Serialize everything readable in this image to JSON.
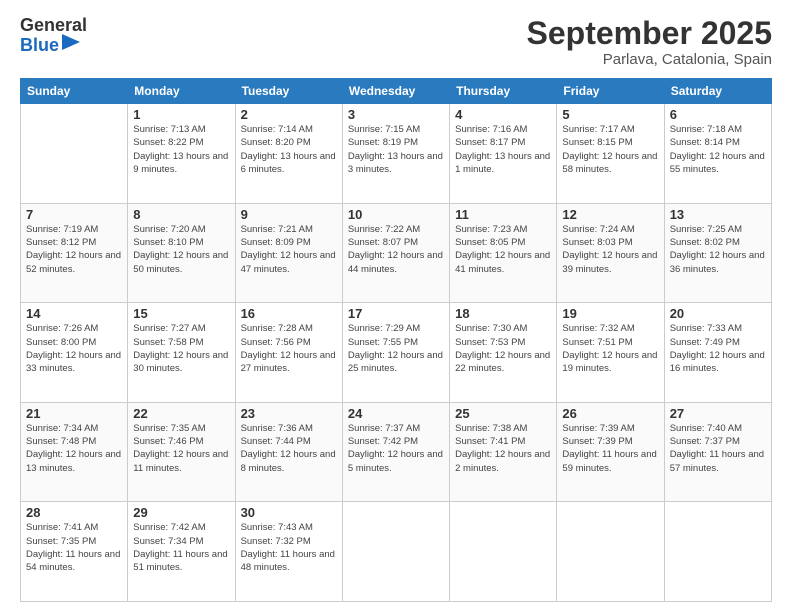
{
  "logo": {
    "general": "General",
    "blue": "Blue"
  },
  "header": {
    "month": "September 2025",
    "location": "Parlava, Catalonia, Spain"
  },
  "weekdays": [
    "Sunday",
    "Monday",
    "Tuesday",
    "Wednesday",
    "Thursday",
    "Friday",
    "Saturday"
  ],
  "weeks": [
    [
      {
        "day": "",
        "sunrise": "",
        "sunset": "",
        "daylight": ""
      },
      {
        "day": "1",
        "sunrise": "Sunrise: 7:13 AM",
        "sunset": "Sunset: 8:22 PM",
        "daylight": "Daylight: 13 hours and 9 minutes."
      },
      {
        "day": "2",
        "sunrise": "Sunrise: 7:14 AM",
        "sunset": "Sunset: 8:20 PM",
        "daylight": "Daylight: 13 hours and 6 minutes."
      },
      {
        "day": "3",
        "sunrise": "Sunrise: 7:15 AM",
        "sunset": "Sunset: 8:19 PM",
        "daylight": "Daylight: 13 hours and 3 minutes."
      },
      {
        "day": "4",
        "sunrise": "Sunrise: 7:16 AM",
        "sunset": "Sunset: 8:17 PM",
        "daylight": "Daylight: 13 hours and 1 minute."
      },
      {
        "day": "5",
        "sunrise": "Sunrise: 7:17 AM",
        "sunset": "Sunset: 8:15 PM",
        "daylight": "Daylight: 12 hours and 58 minutes."
      },
      {
        "day": "6",
        "sunrise": "Sunrise: 7:18 AM",
        "sunset": "Sunset: 8:14 PM",
        "daylight": "Daylight: 12 hours and 55 minutes."
      }
    ],
    [
      {
        "day": "7",
        "sunrise": "Sunrise: 7:19 AM",
        "sunset": "Sunset: 8:12 PM",
        "daylight": "Daylight: 12 hours and 52 minutes."
      },
      {
        "day": "8",
        "sunrise": "Sunrise: 7:20 AM",
        "sunset": "Sunset: 8:10 PM",
        "daylight": "Daylight: 12 hours and 50 minutes."
      },
      {
        "day": "9",
        "sunrise": "Sunrise: 7:21 AM",
        "sunset": "Sunset: 8:09 PM",
        "daylight": "Daylight: 12 hours and 47 minutes."
      },
      {
        "day": "10",
        "sunrise": "Sunrise: 7:22 AM",
        "sunset": "Sunset: 8:07 PM",
        "daylight": "Daylight: 12 hours and 44 minutes."
      },
      {
        "day": "11",
        "sunrise": "Sunrise: 7:23 AM",
        "sunset": "Sunset: 8:05 PM",
        "daylight": "Daylight: 12 hours and 41 minutes."
      },
      {
        "day": "12",
        "sunrise": "Sunrise: 7:24 AM",
        "sunset": "Sunset: 8:03 PM",
        "daylight": "Daylight: 12 hours and 39 minutes."
      },
      {
        "day": "13",
        "sunrise": "Sunrise: 7:25 AM",
        "sunset": "Sunset: 8:02 PM",
        "daylight": "Daylight: 12 hours and 36 minutes."
      }
    ],
    [
      {
        "day": "14",
        "sunrise": "Sunrise: 7:26 AM",
        "sunset": "Sunset: 8:00 PM",
        "daylight": "Daylight: 12 hours and 33 minutes."
      },
      {
        "day": "15",
        "sunrise": "Sunrise: 7:27 AM",
        "sunset": "Sunset: 7:58 PM",
        "daylight": "Daylight: 12 hours and 30 minutes."
      },
      {
        "day": "16",
        "sunrise": "Sunrise: 7:28 AM",
        "sunset": "Sunset: 7:56 PM",
        "daylight": "Daylight: 12 hours and 27 minutes."
      },
      {
        "day": "17",
        "sunrise": "Sunrise: 7:29 AM",
        "sunset": "Sunset: 7:55 PM",
        "daylight": "Daylight: 12 hours and 25 minutes."
      },
      {
        "day": "18",
        "sunrise": "Sunrise: 7:30 AM",
        "sunset": "Sunset: 7:53 PM",
        "daylight": "Daylight: 12 hours and 22 minutes."
      },
      {
        "day": "19",
        "sunrise": "Sunrise: 7:32 AM",
        "sunset": "Sunset: 7:51 PM",
        "daylight": "Daylight: 12 hours and 19 minutes."
      },
      {
        "day": "20",
        "sunrise": "Sunrise: 7:33 AM",
        "sunset": "Sunset: 7:49 PM",
        "daylight": "Daylight: 12 hours and 16 minutes."
      }
    ],
    [
      {
        "day": "21",
        "sunrise": "Sunrise: 7:34 AM",
        "sunset": "Sunset: 7:48 PM",
        "daylight": "Daylight: 12 hours and 13 minutes."
      },
      {
        "day": "22",
        "sunrise": "Sunrise: 7:35 AM",
        "sunset": "Sunset: 7:46 PM",
        "daylight": "Daylight: 12 hours and 11 minutes."
      },
      {
        "day": "23",
        "sunrise": "Sunrise: 7:36 AM",
        "sunset": "Sunset: 7:44 PM",
        "daylight": "Daylight: 12 hours and 8 minutes."
      },
      {
        "day": "24",
        "sunrise": "Sunrise: 7:37 AM",
        "sunset": "Sunset: 7:42 PM",
        "daylight": "Daylight: 12 hours and 5 minutes."
      },
      {
        "day": "25",
        "sunrise": "Sunrise: 7:38 AM",
        "sunset": "Sunset: 7:41 PM",
        "daylight": "Daylight: 12 hours and 2 minutes."
      },
      {
        "day": "26",
        "sunrise": "Sunrise: 7:39 AM",
        "sunset": "Sunset: 7:39 PM",
        "daylight": "Daylight: 11 hours and 59 minutes."
      },
      {
        "day": "27",
        "sunrise": "Sunrise: 7:40 AM",
        "sunset": "Sunset: 7:37 PM",
        "daylight": "Daylight: 11 hours and 57 minutes."
      }
    ],
    [
      {
        "day": "28",
        "sunrise": "Sunrise: 7:41 AM",
        "sunset": "Sunset: 7:35 PM",
        "daylight": "Daylight: 11 hours and 54 minutes."
      },
      {
        "day": "29",
        "sunrise": "Sunrise: 7:42 AM",
        "sunset": "Sunset: 7:34 PM",
        "daylight": "Daylight: 11 hours and 51 minutes."
      },
      {
        "day": "30",
        "sunrise": "Sunrise: 7:43 AM",
        "sunset": "Sunset: 7:32 PM",
        "daylight": "Daylight: 11 hours and 48 minutes."
      },
      {
        "day": "",
        "sunrise": "",
        "sunset": "",
        "daylight": ""
      },
      {
        "day": "",
        "sunrise": "",
        "sunset": "",
        "daylight": ""
      },
      {
        "day": "",
        "sunrise": "",
        "sunset": "",
        "daylight": ""
      },
      {
        "day": "",
        "sunrise": "",
        "sunset": "",
        "daylight": ""
      }
    ]
  ]
}
